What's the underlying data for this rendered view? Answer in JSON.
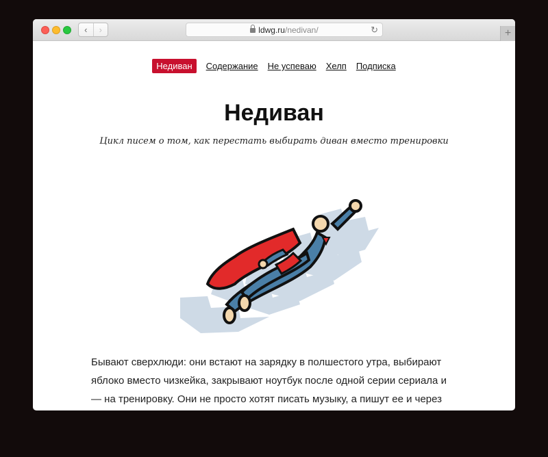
{
  "browser": {
    "url_domain": "ldwg.ru",
    "url_path": "/nedivan/",
    "back_label": "‹",
    "forward_label": "›",
    "reload_label": "↻",
    "new_tab_label": "+"
  },
  "nav": {
    "items": [
      {
        "label": "Недиван",
        "active": true
      },
      {
        "label": "Содержание",
        "active": false
      },
      {
        "label": "Не успеваю",
        "active": false
      },
      {
        "label": "Хелп",
        "active": false
      },
      {
        "label": "Подписка",
        "active": false
      }
    ]
  },
  "hero": {
    "title": "Недиван",
    "subtitle": "Цикл писем о том, как перестать выбирать диван вместо тренировки"
  },
  "article": {
    "paragraph": "Бывают сверхлюди: они встают на зарядку в полшестого утра, выбирают яб­локо вместо чизкейка, закрывают ноутбук после одной серии сериала и — на тренировку. Они не просто хотят писать музыку, а пишут ее и через год выпускают альбом."
  },
  "colors": {
    "accent": "#c8102e",
    "hero_suit": "#4a7fa7",
    "cape": "#e22a2a",
    "stairs": "#c9d6e4"
  },
  "icons": {
    "lock": "lock-icon",
    "reload": "reload-icon",
    "illustration": "superhero-flying-upstairs"
  }
}
